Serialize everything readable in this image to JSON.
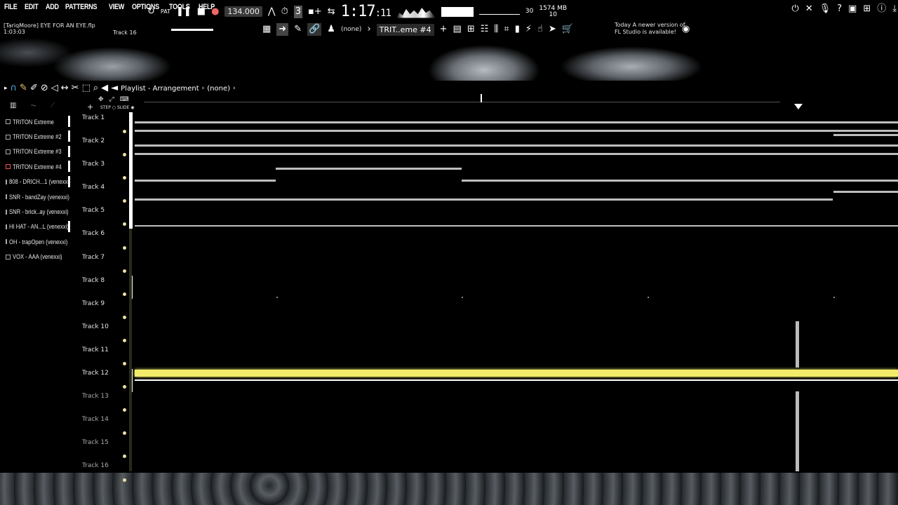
{
  "menu": [
    "FILE",
    "EDIT",
    "ADD",
    "PATTERNS",
    "VIEW",
    "OPTIONS",
    "TOOLS",
    "HELP"
  ],
  "transport": {
    "bpm": "134.000",
    "time": "1:17",
    "time_small": ":11",
    "cpu_top": "30",
    "mem": "1574 MB",
    "voices": "10"
  },
  "project": {
    "title": "[TariqMoore] EYE FOR AN EYE.flp",
    "position": "1:03:03",
    "track_indicator": "Track 16"
  },
  "toolbar2": {
    "snap": "(none)",
    "pattern": "TRIT..eme #4"
  },
  "update": {
    "line1": "Today  A newer version of",
    "line2": "FL Studio is available!"
  },
  "playlist": {
    "title": "Playlist - Arrangement",
    "breadcrumb": "(none)",
    "step_label": "STEP",
    "slide_label": "SLIDE"
  },
  "channels": [
    {
      "name": "TRITON Extreme"
    },
    {
      "name": "TRITON Extreme #2"
    },
    {
      "name": "TRITON Extreme #3"
    },
    {
      "name": "TRITON Extreme #4"
    },
    {
      "name": "808 - DRICH...1 (venexxi)"
    },
    {
      "name": "SNR - bandZay (venexxi)"
    },
    {
      "name": "SNR - brick..ay (venexxi)"
    },
    {
      "name": "HI HAT - AN...L (venexxi)"
    },
    {
      "name": "OH - trapOpen (venexxi)"
    },
    {
      "name": "VOX - AAA (venexxi)"
    }
  ],
  "tracks": [
    "Track 1",
    "Track 2",
    "Track 3",
    "Track 4",
    "Track 5",
    "Track 6",
    "Track 7",
    "Track 8",
    "Track 9",
    "Track 10",
    "Track 11",
    "Track 12",
    "Track 13",
    "Track 14",
    "Track 15",
    "Track 16"
  ],
  "colors": {
    "accent": "#f2ec6a",
    "background": "#000000",
    "text": "#e6e6e6"
  },
  "icons": [
    "undo-icon",
    "pause-icon",
    "stop-icon",
    "record-icon",
    "metronome-icon",
    "mixer-icon",
    "piano-icon",
    "browser-icon",
    "help-icon",
    "save-icon",
    "info-icon",
    "download-icon"
  ]
}
